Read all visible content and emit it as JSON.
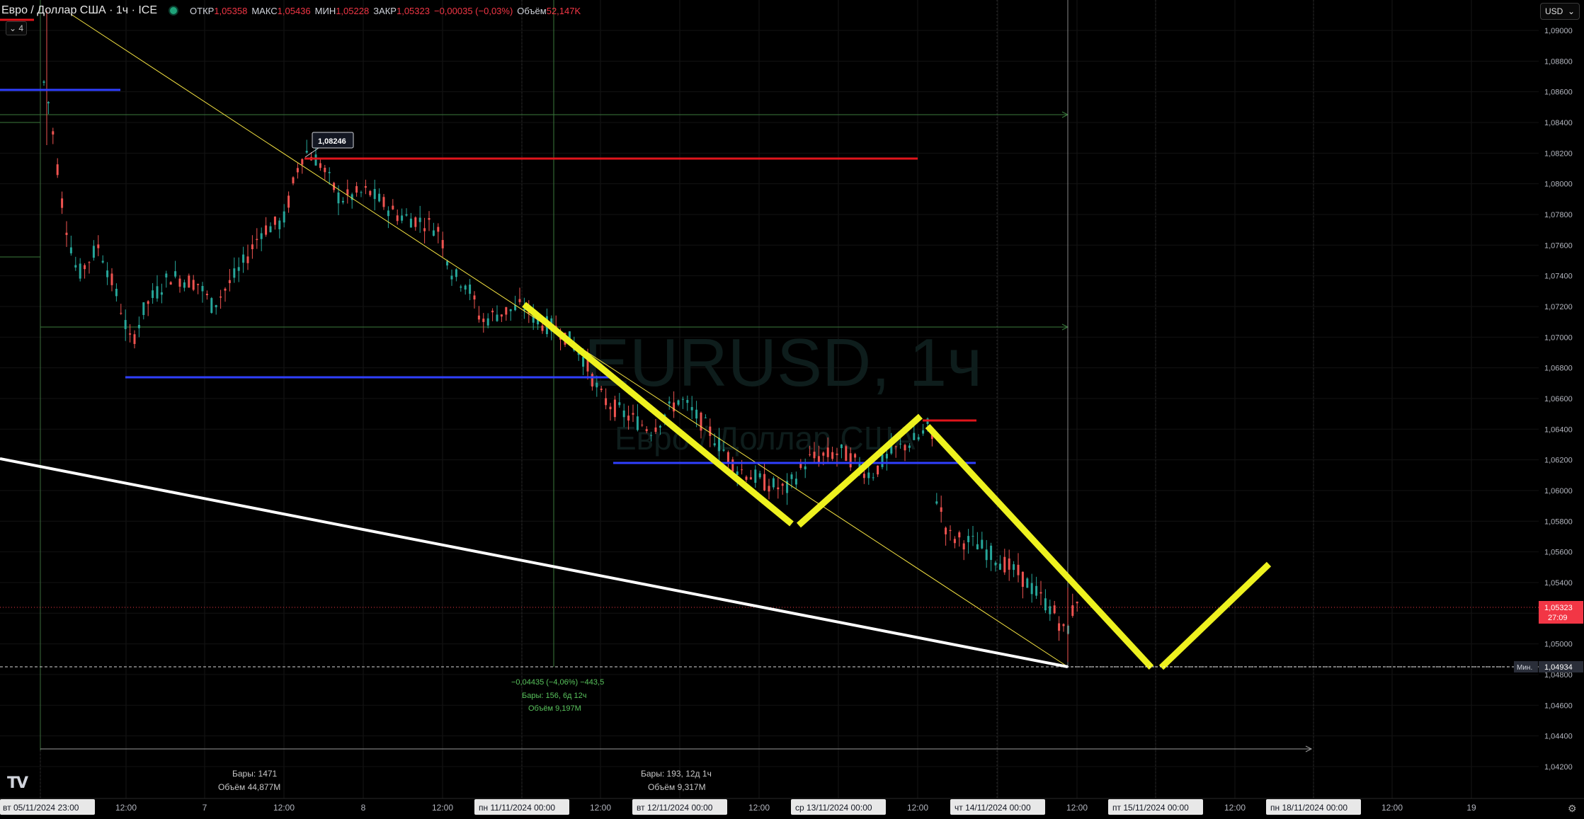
{
  "legend": {
    "symbol_title": "Евро / Доллар США · 1ч · ICE",
    "open_label": "ОТКР",
    "open_value": "1,05358",
    "high_label": "МАКС",
    "high_value": "1,05436",
    "low_label": "МИН",
    "low_value": "1,05228",
    "close_label": "ЗАКР",
    "close_value": "1,05323",
    "change_value": "−0,00035 (−0,03%)",
    "volume_label": "Объём",
    "volume_value": "52,147K"
  },
  "indicators_toggle": {
    "count": "4",
    "chevron": "⌄"
  },
  "currency_selector": {
    "label": "USD",
    "chevron": "⌄"
  },
  "watermark": {
    "symbol": "EURUSD, 1ч",
    "description": "Евро / Доллар США"
  },
  "price_axis": {
    "labels": [
      "1,09000",
      "1,08800",
      "1,08600",
      "1,08400",
      "1,08200",
      "1,08000",
      "1,07800",
      "1,07600",
      "1,07400",
      "1,07200",
      "1,07000",
      "1,06800",
      "1,06600",
      "1,06400",
      "1,06200",
      "1,06000",
      "1,05800",
      "1,05600",
      "1,05400",
      "1,05200",
      "1,05000",
      "1,04800",
      "1,04600",
      "1,04400",
      "1,04200"
    ],
    "current_price": "1,05323",
    "countdown": "27:09",
    "min_label": "Мин.",
    "min_value": "1,04934"
  },
  "time_axis": [
    {
      "label": "вт 05/11/2024   23:00",
      "boxed": true
    },
    {
      "label": "12:00"
    },
    {
      "label": "7"
    },
    {
      "label": "12:00"
    },
    {
      "label": "8"
    },
    {
      "label": "12:00"
    },
    {
      "label": "пн 11/11/2024   00:00",
      "boxed": true
    },
    {
      "label": "12:00"
    },
    {
      "label": "вт 12/11/2024   00:00",
      "boxed": true
    },
    {
      "label": "12:00"
    },
    {
      "label": "ср 13/11/2024   00:00",
      "boxed": true
    },
    {
      "label": "12:00"
    },
    {
      "label": "чт 14/11/2024   00:00",
      "boxed": true
    },
    {
      "label": "12:00"
    },
    {
      "label": "пт 15/11/2024   00:00",
      "boxed": true
    },
    {
      "label": "12:00"
    },
    {
      "label": "пн 18/11/2024   00:00",
      "boxed": true
    },
    {
      "label": "12:00"
    },
    {
      "label": "19"
    }
  ],
  "annotations": {
    "price_tag": "1,08246",
    "measure_change": "−0,04435 (−4,06%) −443,5",
    "measure_bars": "Бары: 156, 6д 12ч",
    "measure_volume": "Объём 9,197M",
    "range1_bars": "Бары: 1471",
    "range1_volume": "Объём 44,877M",
    "range2_bars": "Бары: 193, 12д 1ч",
    "range2_volume": "Объём 9,317M"
  },
  "logo": "TV",
  "settings_icon": "⚙",
  "colors": {
    "background": "#000000",
    "up_candle": "#26a69a",
    "down_candle": "#ef5350",
    "trendline": "#f5e342",
    "zigzag": "#eef21f",
    "support_blue": "#2f3fff",
    "resistance_red": "#e0151b",
    "long_trend": "#ffffff",
    "price_tag_bg": "#f23645",
    "measure_text": "#58c25c"
  }
}
